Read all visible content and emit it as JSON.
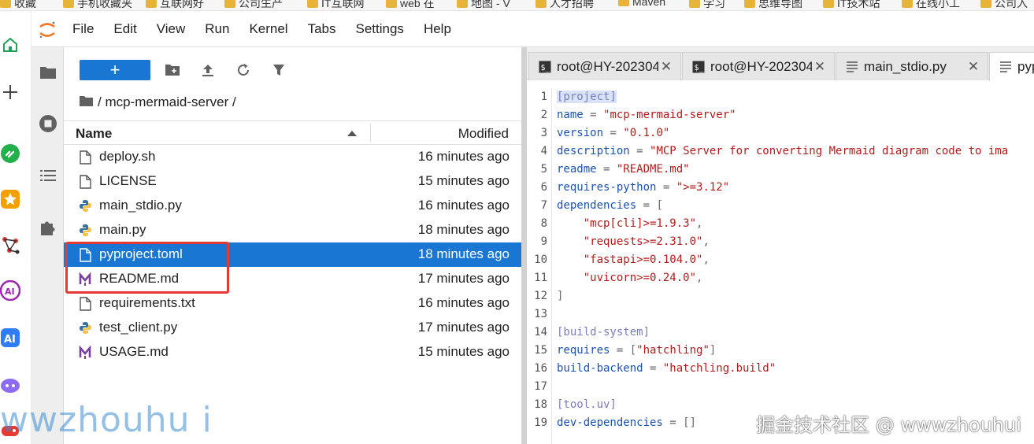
{
  "browser": {
    "bookmarks": [
      "收藏",
      "手机收藏夹",
      "互联网好",
      "公司生产",
      "IT互联网",
      "web 在",
      "地图 - V",
      "人才招聘",
      "Maven",
      "学习",
      "思维导图",
      "IT技术站",
      "在线小工",
      "公司入"
    ]
  },
  "menubar": {
    "items": [
      "File",
      "Edit",
      "View",
      "Run",
      "Kernel",
      "Tabs",
      "Settings",
      "Help"
    ]
  },
  "filebrowser": {
    "new_label": "+",
    "breadcrumb": "/ mcp-mermaid-server /",
    "columns": {
      "name": "Name",
      "modified": "Modified"
    },
    "files": [
      {
        "name": "deploy.sh",
        "modified": "16 minutes ago",
        "icon": "file-icon"
      },
      {
        "name": "LICENSE",
        "modified": "15 minutes ago",
        "icon": "file-icon"
      },
      {
        "name": "main_stdio.py",
        "modified": "16 minutes ago",
        "icon": "python-icon"
      },
      {
        "name": "main.py",
        "modified": "18 minutes ago",
        "icon": "python-icon"
      },
      {
        "name": "pyproject.toml",
        "modified": "18 minutes ago",
        "icon": "file-icon",
        "selected": true
      },
      {
        "name": "README.md",
        "modified": "17 minutes ago",
        "icon": "markdown-icon"
      },
      {
        "name": "requirements.txt",
        "modified": "16 minutes ago",
        "icon": "file-icon"
      },
      {
        "name": "test_client.py",
        "modified": "17 minutes ago",
        "icon": "python-icon"
      },
      {
        "name": "USAGE.md",
        "modified": "15 minutes ago",
        "icon": "markdown-icon"
      }
    ]
  },
  "tabs": [
    {
      "label": "root@HY-202304",
      "icon": "terminal-icon"
    },
    {
      "label": "root@HY-202304",
      "icon": "terminal-icon"
    },
    {
      "label": "main_stdio.py",
      "icon": "text-file-icon"
    },
    {
      "label": "pyp",
      "icon": "text-file-icon",
      "active": true
    }
  ],
  "editor": {
    "line_numbers": [
      "1",
      "2",
      "3",
      "4",
      "5",
      "6",
      "7",
      "8",
      "9",
      "10",
      "11",
      "12",
      "13",
      "14",
      "15",
      "16",
      "17",
      "18",
      "19"
    ],
    "lines": [
      [
        {
          "t": "[project]",
          "c": "c-sec c-sel"
        }
      ],
      [
        {
          "t": "name",
          "c": "c-key"
        },
        {
          "t": " = ",
          "c": "c-op"
        },
        {
          "t": "\"mcp-mermaid-server\"",
          "c": "c-str"
        }
      ],
      [
        {
          "t": "version",
          "c": "c-key"
        },
        {
          "t": " = ",
          "c": "c-op"
        },
        {
          "t": "\"0.1.0\"",
          "c": "c-str"
        }
      ],
      [
        {
          "t": "description",
          "c": "c-key"
        },
        {
          "t": " = ",
          "c": "c-op"
        },
        {
          "t": "\"MCP Server for converting Mermaid diagram code to ima",
          "c": "c-str"
        }
      ],
      [
        {
          "t": "readme",
          "c": "c-key"
        },
        {
          "t": " = ",
          "c": "c-op"
        },
        {
          "t": "\"README.md\"",
          "c": "c-str"
        }
      ],
      [
        {
          "t": "requires-python",
          "c": "c-key"
        },
        {
          "t": " = ",
          "c": "c-op"
        },
        {
          "t": "\">=3.12\"",
          "c": "c-str"
        }
      ],
      [
        {
          "t": "dependencies",
          "c": "c-key"
        },
        {
          "t": " = ",
          "c": "c-op"
        },
        {
          "t": "[",
          "c": "c-brk"
        }
      ],
      [
        {
          "t": "    \"mcp[cli]>=1.9.3\"",
          "c": "c-str"
        },
        {
          "t": ",",
          "c": "c-op"
        }
      ],
      [
        {
          "t": "    \"requests>=2.31.0\"",
          "c": "c-str"
        },
        {
          "t": ",",
          "c": "c-op"
        }
      ],
      [
        {
          "t": "    \"fastapi>=0.104.0\"",
          "c": "c-str"
        },
        {
          "t": ",",
          "c": "c-op"
        }
      ],
      [
        {
          "t": "    \"uvicorn>=0.24.0\"",
          "c": "c-str"
        },
        {
          "t": ",",
          "c": "c-op"
        }
      ],
      [
        {
          "t": "]",
          "c": "c-brk"
        }
      ],
      [],
      [
        {
          "t": "[build-system]",
          "c": "c-sec"
        }
      ],
      [
        {
          "t": "requires",
          "c": "c-key"
        },
        {
          "t": " = ",
          "c": "c-op"
        },
        {
          "t": "[",
          "c": "c-brk"
        },
        {
          "t": "\"hatchling\"",
          "c": "c-str"
        },
        {
          "t": "]",
          "c": "c-brk"
        }
      ],
      [
        {
          "t": "build-backend",
          "c": "c-key"
        },
        {
          "t": " = ",
          "c": "c-op"
        },
        {
          "t": "\"hatchling.build\"",
          "c": "c-str"
        }
      ],
      [],
      [
        {
          "t": "[tool.uv]",
          "c": "c-sec"
        }
      ],
      [
        {
          "t": "dev-dependencies",
          "c": "c-key"
        },
        {
          "t": " = ",
          "c": "c-op"
        },
        {
          "t": "[]",
          "c": "c-brk"
        }
      ]
    ]
  },
  "watermarks": {
    "left": "wwzhouhu i",
    "right": "掘金技术社区 @ wwwzhouhui"
  },
  "colors": {
    "accent": "#1976d2",
    "highlight_box": "#e53935",
    "activity_bg": "#eeeeee"
  }
}
